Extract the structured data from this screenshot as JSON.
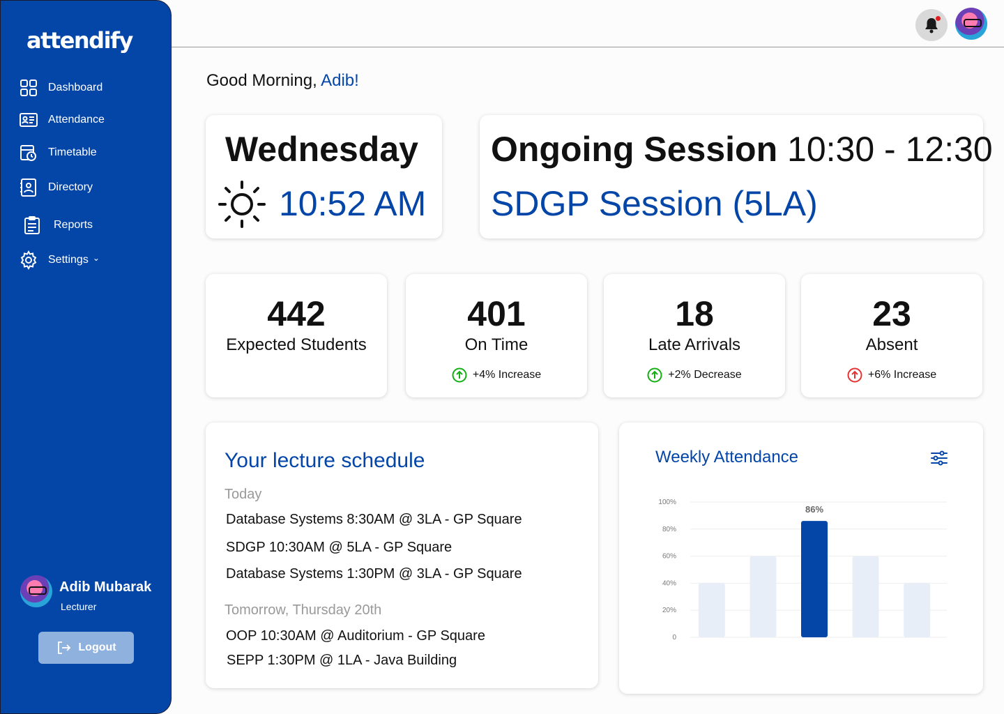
{
  "app": {
    "logo": "attendify"
  },
  "sidebar": {
    "items": [
      {
        "label": "Dashboard",
        "icon": "grid-icon"
      },
      {
        "label": "Attendance",
        "icon": "id-card-icon"
      },
      {
        "label": "Timetable",
        "icon": "calendar-clock-icon"
      },
      {
        "label": "Directory",
        "icon": "contact-book-icon"
      },
      {
        "label": "Reports",
        "icon": "clipboard-icon"
      },
      {
        "label": "Settings",
        "icon": "gear-icon",
        "chevron": "⌄"
      }
    ],
    "profile": {
      "name": "Adib Mubarak",
      "role": "Lecturer"
    },
    "logout_label": "Logout"
  },
  "greeting": {
    "prefix": "Good Morning, ",
    "name": "Adib!"
  },
  "today": {
    "day": "Wednesday",
    "time": "10:52 AM"
  },
  "session": {
    "title": "Ongoing Session",
    "range": "10:30 - 12:30",
    "name": "SDGP Session (5LA)"
  },
  "stats": [
    {
      "value": "442",
      "label": "Expected Students",
      "delta": ""
    },
    {
      "value": "401",
      "label": "On Time",
      "delta": "+4% Increase",
      "status": "up-green"
    },
    {
      "value": "18",
      "label": "Late Arrivals",
      "delta": "+2% Decrease",
      "status": "up-green"
    },
    {
      "value": "23",
      "label": "Absent",
      "delta": "+6% Increase",
      "status": "up-red"
    }
  ],
  "schedule": {
    "title": "Your lecture schedule",
    "today_label": "Today",
    "today": [
      "Database Systems 8:30AM @ 3LA - GP Square",
      "SDGP 10:30AM @ 5LA - GP Square",
      "Database Systems 1:30PM @ 3LA - GP Square"
    ],
    "tomorrow_label": "Tomorrow, Thursday 20th",
    "tomorrow": [
      "OOP 10:30AM @ Auditorium - GP Square",
      "SEPP 1:30PM @ 1LA - Java Building"
    ]
  },
  "chart_data": {
    "type": "bar",
    "title": "Weekly Attendance",
    "categories": [
      "",
      "",
      "",
      "",
      ""
    ],
    "values": [
      40,
      60,
      86,
      60,
      40
    ],
    "highlight_index": 2,
    "highlight_label": "86%",
    "yticks": [
      "0",
      "20%",
      "40%",
      "60%",
      "80%",
      "100%"
    ],
    "ylim": [
      0,
      100
    ],
    "grid": true,
    "colors": {
      "bar": "#e8eef7",
      "highlight": "#0446a8"
    }
  },
  "colors": {
    "brand": "#0446a8",
    "green": "#13b013",
    "red": "#e53232"
  }
}
